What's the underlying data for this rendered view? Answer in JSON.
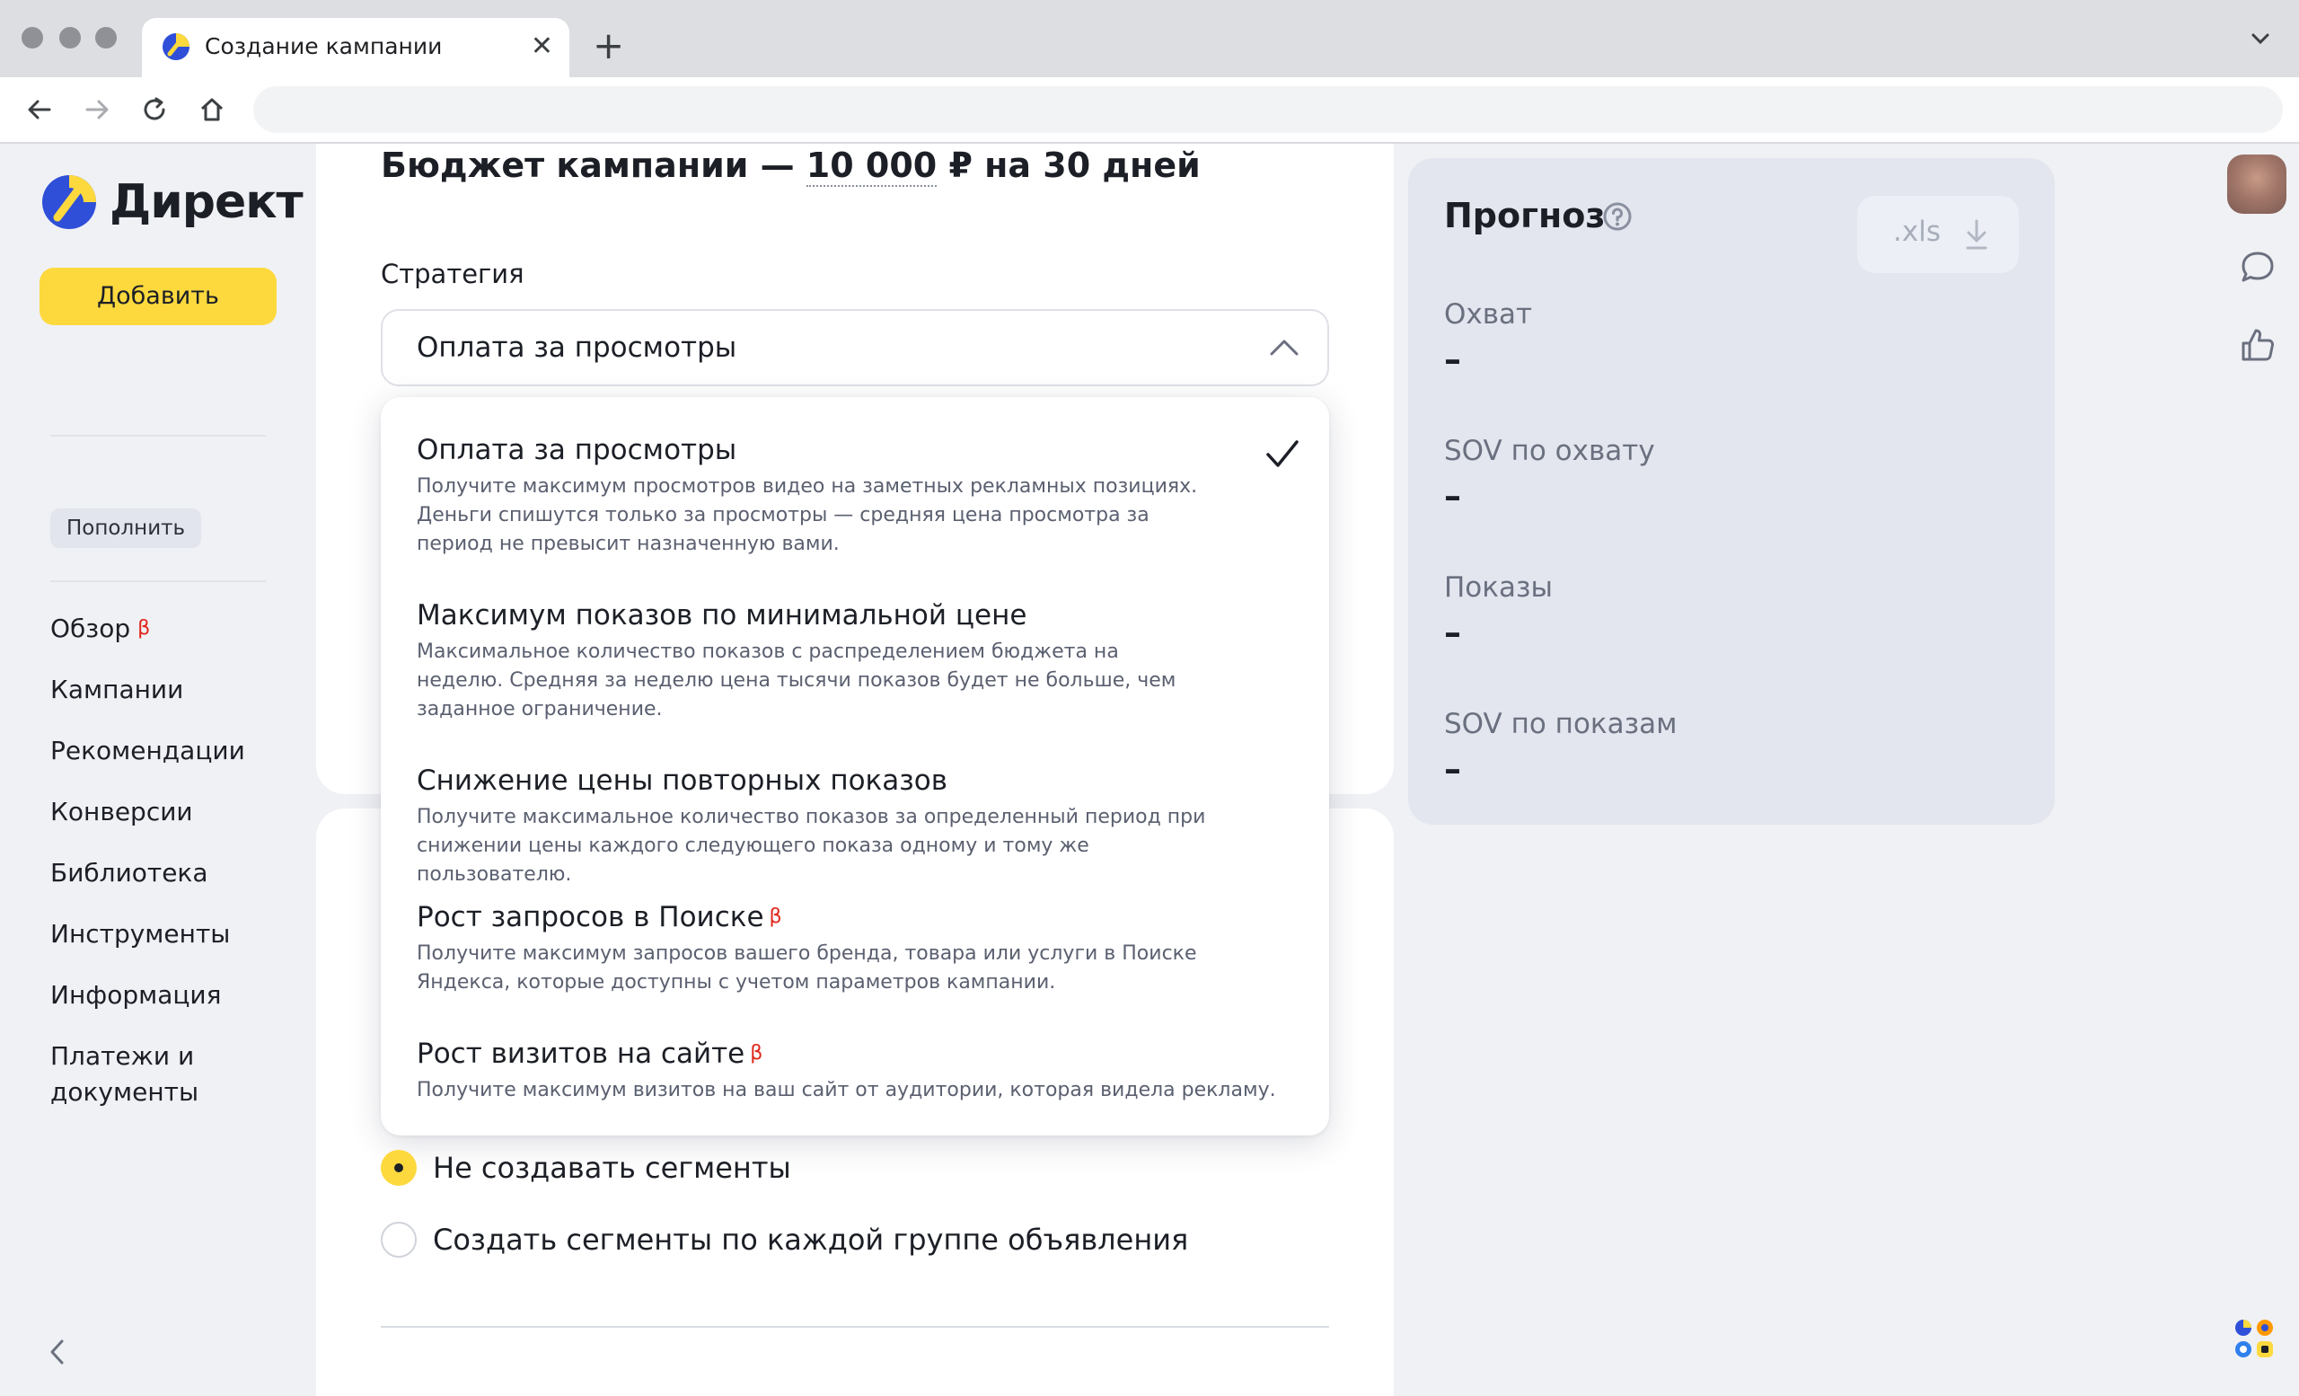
{
  "browser": {
    "tab_title": "Создание кампании",
    "new_tab_label": "+",
    "close_label": "✕"
  },
  "sidebar": {
    "logo_text": "Директ",
    "add_button": "Добавить",
    "topup_button": "Пополнить",
    "nav": [
      {
        "label": "Обзор",
        "beta": "β"
      },
      {
        "label": "Кампании"
      },
      {
        "label": "Рекомендации"
      },
      {
        "label": "Конверсии"
      },
      {
        "label": "Библиотека"
      },
      {
        "label": "Инструменты"
      },
      {
        "label": "Информация"
      },
      {
        "label": "Платежи и документы"
      }
    ]
  },
  "main": {
    "budget_prefix": "Бюджет кампании — ",
    "budget_amount": "10 000",
    "budget_suffix": " ₽ на 30 дней",
    "strategy_label": "Стратегия",
    "strategy_selected": "Оплата за просмотры",
    "strategy_options": [
      {
        "title": "Оплата за просмотры",
        "desc": "Получите максимум просмотров видео на заметных рекламных позициях. Деньги спишутся только за просмотры — средняя цена просмотра за период не превысит назначенную вами.",
        "selected": true
      },
      {
        "title": "Максимум показов по минимальной цене",
        "desc": "Максимальное количество показов с распределением бюджета на неделю. Средняя за неделю цена тысячи показов будет не больше, чем заданное ограничение."
      },
      {
        "title": "Снижение цены повторных показов",
        "desc": "Получите максимальное количество показов за определенный период при снижении цены каждого следующего показа одному и тому же пользователю."
      },
      {
        "title": "Рост запросов в Поиске",
        "beta": "β",
        "desc": "Получите максимум запросов вашего бренда, товара или услуги в Поиске Яндекса, которые доступны с учетом параметров кампании."
      },
      {
        "title": "Рост визитов на сайте",
        "beta": "β",
        "desc": "Получите максимум визитов на ваш сайт от аудитории, которая видела рекламу."
      }
    ],
    "segments": [
      {
        "label": "Не создавать сегменты",
        "checked": true
      },
      {
        "label": "Создать сегменты по каждой группе объявления",
        "checked": false
      }
    ]
  },
  "forecast": {
    "title": "Прогноз",
    "xls_label": ".xls",
    "metrics": [
      {
        "label": "Охват",
        "value": "–"
      },
      {
        "label": "SOV по охвату",
        "value": "–"
      },
      {
        "label": "Показы",
        "value": "–"
      },
      {
        "label": "SOV по показам",
        "value": "–"
      }
    ]
  },
  "colors": {
    "accent_yellow": "#fdd93e",
    "beta_red": "#e0261b",
    "logo_blue": "#2f4fd8"
  }
}
